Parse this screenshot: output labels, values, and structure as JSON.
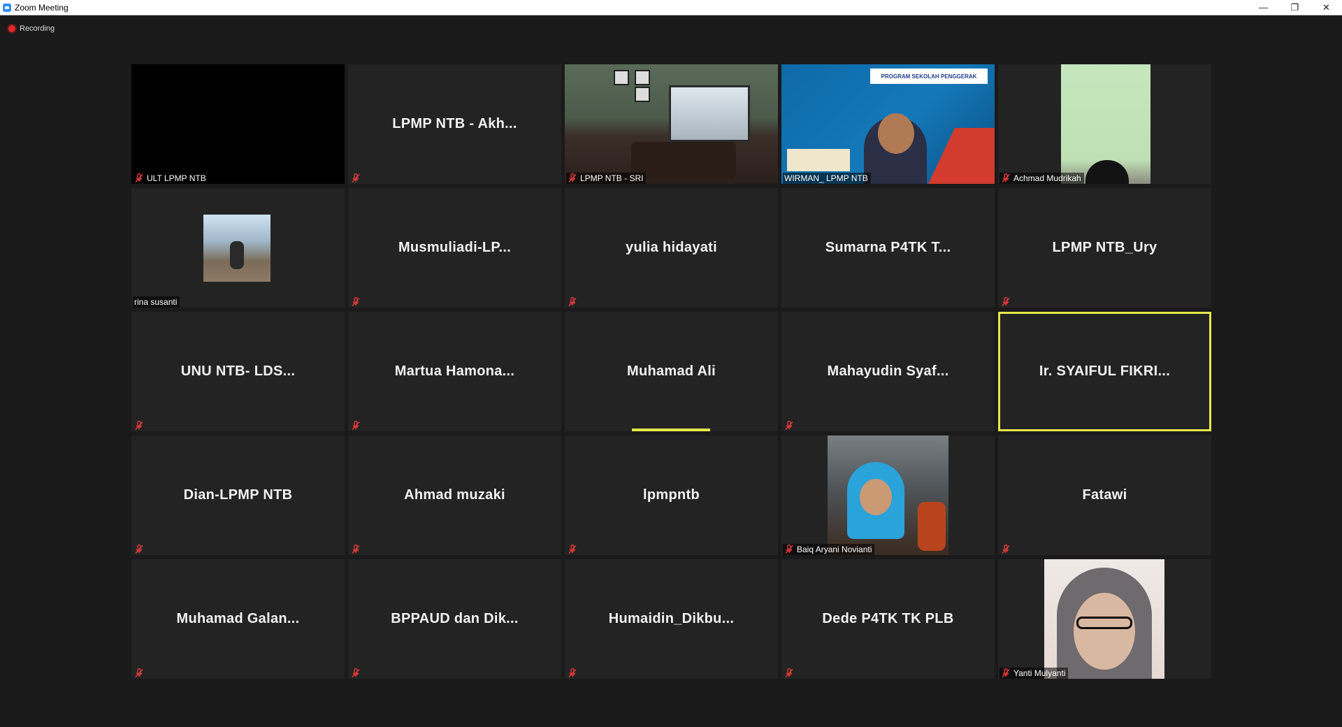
{
  "window": {
    "title": "Zoom Meeting",
    "controls": {
      "minimize": "—",
      "restore": "❐",
      "close": "✕"
    }
  },
  "recording": {
    "label": "Recording",
    "color": "#e02828"
  },
  "colors": {
    "active_speaker": "#e6e84a",
    "tile_bg": "#232323",
    "page_bg": "#1a1a1a",
    "mute": "#e03a3a"
  },
  "participants": [
    {
      "name": "ULT LPMP NTB",
      "display": "",
      "muted": true,
      "video": "black"
    },
    {
      "name": "",
      "display": "LPMP NTB - Akh...",
      "muted": true,
      "video": "none"
    },
    {
      "name": "LPMP NTB - SRI",
      "display": "",
      "muted": true,
      "video": "room"
    },
    {
      "name": "WIRMAN_ LPMP NTB",
      "display": "",
      "muted": false,
      "video": "presenter",
      "banner": "PROGRAM SEKOLAH PENGGERAK"
    },
    {
      "name": "Achmad Mudrikah",
      "display": "",
      "muted": true,
      "video": "green"
    },
    {
      "name": "rina susanti",
      "display": "",
      "muted": false,
      "video": "thumbnail"
    },
    {
      "name": "",
      "display": "Musmuliadi-LP...",
      "muted": true,
      "video": "none"
    },
    {
      "name": "",
      "display": "yulia hidayati",
      "muted": true,
      "video": "none"
    },
    {
      "name": "",
      "display": "Sumarna P4TK T...",
      "muted": false,
      "video": "none"
    },
    {
      "name": "",
      "display": "LPMP NTB_Ury",
      "muted": true,
      "video": "none"
    },
    {
      "name": "",
      "display": "UNU NTB- LDS...",
      "muted": true,
      "video": "none"
    },
    {
      "name": "",
      "display": "Martua Hamona...",
      "muted": true,
      "video": "none"
    },
    {
      "name": "",
      "display": "Muhamad Ali",
      "muted": false,
      "video": "none",
      "speaking_bar": true
    },
    {
      "name": "",
      "display": "Mahayudin Syaf...",
      "muted": true,
      "video": "none"
    },
    {
      "name": "",
      "display": "Ir. SYAIFUL FIKRI...",
      "muted": false,
      "video": "none",
      "active_speaker": true
    },
    {
      "name": "",
      "display": "Dian-LPMP NTB",
      "muted": true,
      "video": "none"
    },
    {
      "name": "",
      "display": "Ahmad muzaki",
      "muted": true,
      "video": "none"
    },
    {
      "name": "",
      "display": "lpmpntb",
      "muted": true,
      "video": "none"
    },
    {
      "name": "Baiq Aryani Novianti",
      "display": "",
      "muted": true,
      "video": "hijab-blue"
    },
    {
      "name": "",
      "display": "Fatawi",
      "muted": true,
      "video": "none"
    },
    {
      "name": "",
      "display": "Muhamad Galan...",
      "muted": true,
      "video": "none"
    },
    {
      "name": "",
      "display": "BPPAUD dan Dik...",
      "muted": true,
      "video": "none"
    },
    {
      "name": "",
      "display": "Humaidin_Dikbu...",
      "muted": true,
      "video": "none"
    },
    {
      "name": "",
      "display": "Dede P4TK TK PLB",
      "muted": true,
      "video": "none"
    },
    {
      "name": "Yanti Mulyanti",
      "display": "",
      "muted": true,
      "video": "hijab-grey"
    }
  ]
}
